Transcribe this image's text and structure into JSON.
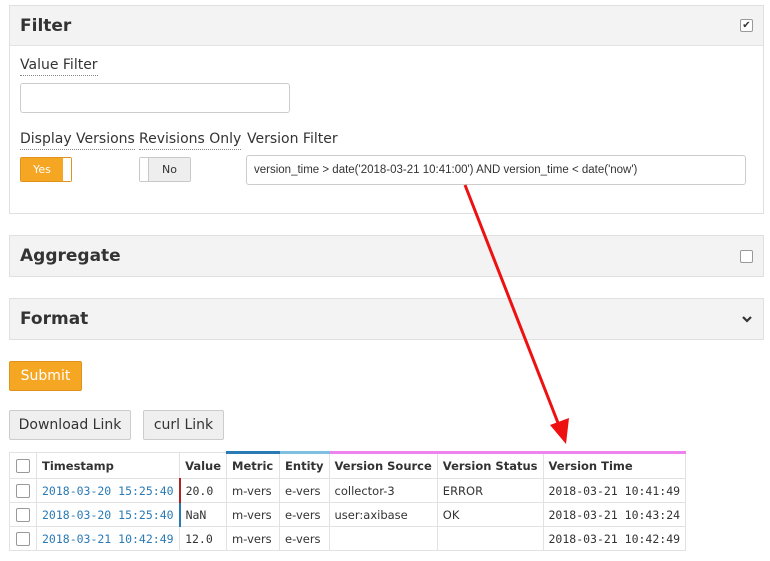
{
  "filter": {
    "title": "Filter",
    "header_checkbox": "✔",
    "value_filter_label": "Value Filter",
    "value_filter_value": "",
    "display_versions_label": "Display Versions",
    "display_versions_toggle": "Yes",
    "revisions_only_label": "Revisions Only",
    "revisions_only_toggle": "No",
    "version_filter_label": "Version Filter",
    "version_filter_value": "version_time > date('2018-03-21 10:41:00') AND version_time < date('now')"
  },
  "aggregate": {
    "title": "Aggregate"
  },
  "format": {
    "title": "Format",
    "chevron": "⌄"
  },
  "actions": {
    "submit": "Submit",
    "download_link": "Download Link",
    "curl_link": "curl Link"
  },
  "colors": {
    "accent": "#f5a623",
    "metric_bar": "#2a7ab5",
    "entity_bar": "#7fbfdf",
    "version_bar": "#ee82ee",
    "arrow": "#ee1111"
  },
  "table": {
    "columns": [
      "Timestamp",
      "Value",
      "Metric",
      "Entity",
      "Version Source",
      "Version Status",
      "Version Time"
    ],
    "rows": [
      [
        "2018-03-20 15:25:40",
        "20.0",
        "m-vers",
        "e-vers",
        "collector-3",
        "ERROR",
        "2018-03-21 10:41:49"
      ],
      [
        "2018-03-20 15:25:40",
        "NaN",
        "m-vers",
        "e-vers",
        "user:axibase",
        "OK",
        "2018-03-21 10:43:24"
      ],
      [
        "2018-03-21 10:42:49",
        "12.0",
        "m-vers",
        "e-vers",
        "",
        "",
        "2018-03-21 10:42:49"
      ]
    ]
  }
}
